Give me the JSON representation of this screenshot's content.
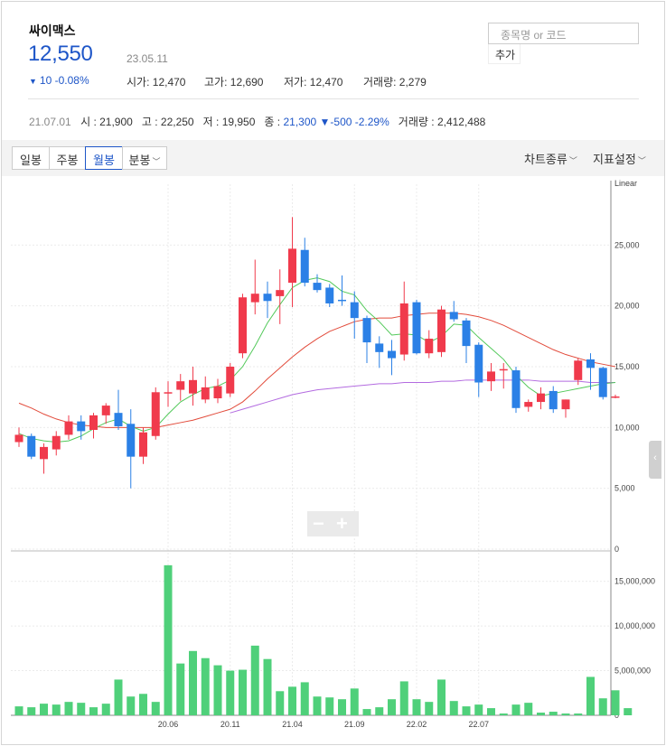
{
  "stock": {
    "name": "싸이맥스",
    "price": "12,550",
    "date": "23.05.11",
    "change_arrow": "▼",
    "change": "10 -0.08%",
    "quotes": [
      {
        "label": "시가",
        "value": "12,470"
      },
      {
        "label": "고가",
        "value": "12,690"
      },
      {
        "label": "저가",
        "value": "12,470"
      },
      {
        "label": "거래량",
        "value": "2,279"
      }
    ]
  },
  "search": {
    "placeholder": "종목명 or 코드",
    "add_label": "추가"
  },
  "history": {
    "date": "21.07.01",
    "open_label": "시",
    "open": "21,900",
    "high_label": "고",
    "high": "22,250",
    "low_label": "저",
    "low": "19,950",
    "close_label": "종",
    "close": "21,300",
    "change_arrow": "▼",
    "change": "-500 -2.29%",
    "volume_label": "거래량",
    "volume": "2,412,488"
  },
  "toolbar": {
    "periods": [
      "일봉",
      "주봉",
      "월봉",
      "분봉"
    ],
    "active_period": "월봉",
    "chart_type": "차트종류",
    "indicators": "지표설정"
  },
  "colors": {
    "up": "#f03a4c",
    "down": "#2b80e6",
    "accent": "#1e56c8",
    "volume": "#4fd07a",
    "ma5": "#52c95a",
    "ma20": "#e24b3b",
    "ma60": "#b36be0"
  },
  "zoom": {
    "minus": "−",
    "plus": "+"
  },
  "chart_data": {
    "type": "candlestick",
    "price_axis": {
      "scale_label": "Linear",
      "ticks": [
        0,
        5000,
        10000,
        15000,
        20000,
        25000
      ],
      "tick_labels": [
        "0",
        "5,000",
        "10,000",
        "15,000",
        "20,000",
        "25,000"
      ],
      "ylim": [
        0,
        30000
      ]
    },
    "volume_axis": {
      "ticks": [
        0,
        5000000,
        10000000,
        15000000
      ],
      "tick_labels": [
        "0",
        "5,000,000",
        "10,000,000",
        "15,000,000"
      ],
      "ylim": [
        0,
        18000000
      ]
    },
    "x_tick_labels": [
      {
        "index": 12,
        "label": "20.06"
      },
      {
        "index": 17,
        "label": "20.11"
      },
      {
        "index": 22,
        "label": "21.04"
      },
      {
        "index": 27,
        "label": "21.09"
      },
      {
        "index": 32,
        "label": "22.02"
      },
      {
        "index": 37,
        "label": "22.07"
      }
    ],
    "candles": [
      {
        "o": 8800,
        "h": 10000,
        "l": 8400,
        "c": 9400
      },
      {
        "o": 9300,
        "h": 9500,
        "l": 7400,
        "c": 7600
      },
      {
        "o": 7400,
        "h": 8700,
        "l": 6200,
        "c": 8400
      },
      {
        "o": 8200,
        "h": 9700,
        "l": 7700,
        "c": 9300
      },
      {
        "o": 9400,
        "h": 11000,
        "l": 9000,
        "c": 10500
      },
      {
        "o": 10500,
        "h": 11000,
        "l": 9000,
        "c": 9700
      },
      {
        "o": 9800,
        "h": 11200,
        "l": 9100,
        "c": 11000
      },
      {
        "o": 11000,
        "h": 12000,
        "l": 10300,
        "c": 11800
      },
      {
        "o": 11200,
        "h": 13100,
        "l": 9800,
        "c": 10100
      },
      {
        "o": 10300,
        "h": 11500,
        "l": 5000,
        "c": 7600
      },
      {
        "o": 7600,
        "h": 10000,
        "l": 7000,
        "c": 9600
      },
      {
        "o": 9300,
        "h": 13300,
        "l": 9000,
        "c": 12900
      },
      {
        "o": 12800,
        "h": 13800,
        "l": 11700,
        "c": 12900
      },
      {
        "o": 13100,
        "h": 14400,
        "l": 12200,
        "c": 13800
      },
      {
        "o": 12800,
        "h": 15000,
        "l": 11800,
        "c": 13900
      },
      {
        "o": 12300,
        "h": 14200,
        "l": 12000,
        "c": 13300
      },
      {
        "o": 12400,
        "h": 14000,
        "l": 12000,
        "c": 13400
      },
      {
        "o": 12800,
        "h": 15300,
        "l": 12500,
        "c": 15000
      },
      {
        "o": 16100,
        "h": 21000,
        "l": 15700,
        "c": 20700
      },
      {
        "o": 20300,
        "h": 23800,
        "l": 19300,
        "c": 21000
      },
      {
        "o": 21000,
        "h": 22000,
        "l": 19000,
        "c": 20400
      },
      {
        "o": 20800,
        "h": 23000,
        "l": 18500,
        "c": 21300
      },
      {
        "o": 21900,
        "h": 27300,
        "l": 19900,
        "c": 24700
      },
      {
        "o": 24600,
        "h": 25600,
        "l": 21600,
        "c": 21900
      },
      {
        "o": 21900,
        "h": 22600,
        "l": 21100,
        "c": 21300
      },
      {
        "o": 21500,
        "h": 21800,
        "l": 19900,
        "c": 20200
      },
      {
        "o": 20500,
        "h": 22500,
        "l": 20000,
        "c": 20400
      },
      {
        "o": 20300,
        "h": 21200,
        "l": 17300,
        "c": 19000
      },
      {
        "o": 19000,
        "h": 19200,
        "l": 15300,
        "c": 17000
      },
      {
        "o": 16900,
        "h": 17500,
        "l": 14900,
        "c": 16200
      },
      {
        "o": 16300,
        "h": 17200,
        "l": 14300,
        "c": 15700
      },
      {
        "o": 16000,
        "h": 22000,
        "l": 15500,
        "c": 20200
      },
      {
        "o": 20300,
        "h": 20500,
        "l": 16000,
        "c": 16100
      },
      {
        "o": 16100,
        "h": 18000,
        "l": 15700,
        "c": 17300
      },
      {
        "o": 16200,
        "h": 20000,
        "l": 15800,
        "c": 19700
      },
      {
        "o": 19500,
        "h": 20400,
        "l": 18700,
        "c": 18900
      },
      {
        "o": 18800,
        "h": 19000,
        "l": 15300,
        "c": 16700
      },
      {
        "o": 16800,
        "h": 17000,
        "l": 12500,
        "c": 13700
      },
      {
        "o": 13800,
        "h": 15300,
        "l": 13000,
        "c": 14600
      },
      {
        "o": 14800,
        "h": 15300,
        "l": 13200,
        "c": 14800
      },
      {
        "o": 14700,
        "h": 15000,
        "l": 11200,
        "c": 11600
      },
      {
        "o": 11700,
        "h": 12300,
        "l": 11300,
        "c": 12100
      },
      {
        "o": 12100,
        "h": 13300,
        "l": 11500,
        "c": 12800
      },
      {
        "o": 13000,
        "h": 13400,
        "l": 11200,
        "c": 11500
      },
      {
        "o": 11500,
        "h": 12300,
        "l": 10800,
        "c": 12300
      },
      {
        "o": 13900,
        "h": 15700,
        "l": 13500,
        "c": 15500
      },
      {
        "o": 15600,
        "h": 16100,
        "l": 13100,
        "c": 14900
      },
      {
        "o": 14900,
        "h": 15000,
        "l": 12300,
        "c": 12500
      },
      {
        "o": 12500,
        "h": 12700,
        "l": 12400,
        "c": 12550
      }
    ],
    "volumes": [
      1000000,
      900000,
      1300000,
      1200000,
      1500000,
      1400000,
      900000,
      1300000,
      4000000,
      2100000,
      2400000,
      1500000,
      16800000,
      5800000,
      7200000,
      6400000,
      5600000,
      5000000,
      5100000,
      7800000,
      6300000,
      2700000,
      3200000,
      3700000,
      2100000,
      2000000,
      1800000,
      3000000,
      700000,
      900000,
      1800000,
      3800000,
      1800000,
      1500000,
      4000000,
      1600000,
      1000000,
      1200000,
      800000,
      200000,
      1200000,
      1400000,
      300000,
      400000,
      200000,
      200000,
      4300000,
      1900000,
      2800000,
      800000
    ],
    "ma5": [
      9500,
      9100,
      8900,
      8800,
      8900,
      9300,
      9900,
      10400,
      10700,
      10100,
      9700,
      10000,
      11100,
      12100,
      12700,
      13200,
      13400,
      13900,
      15000,
      16700,
      18600,
      20100,
      21500,
      22100,
      22300,
      22000,
      21200,
      20900,
      19600,
      18700,
      17600,
      17700,
      17600,
      17000,
      17500,
      18500,
      18400,
      17400,
      16500,
      15600,
      14300,
      13300,
      12600,
      12800,
      13000,
      13200,
      13400,
      13600,
      13700
    ],
    "ma20": [
      12000,
      11600,
      11100,
      10700,
      10400,
      10200,
      10100,
      10000,
      10000,
      10000,
      10000,
      10000,
      10200,
      10400,
      10600,
      10900,
      11200,
      11500,
      12100,
      13000,
      14000,
      14900,
      15800,
      16600,
      17300,
      17900,
      18300,
      18700,
      18900,
      19000,
      19000,
      19200,
      19300,
      19400,
      19400,
      19400,
      19300,
      19100,
      18800,
      18400,
      17900,
      17400,
      16900,
      16400,
      16000,
      15700,
      15400,
      15200,
      15000
    ],
    "ma60": [
      null,
      null,
      null,
      null,
      null,
      null,
      null,
      null,
      null,
      null,
      null,
      null,
      null,
      null,
      null,
      null,
      null,
      11200,
      11500,
      11800,
      12100,
      12400,
      12700,
      12900,
      13100,
      13200,
      13300,
      13400,
      13500,
      13600,
      13600,
      13700,
      13700,
      13700,
      13800,
      13800,
      13900,
      13900,
      13900,
      13900,
      13900,
      13900,
      13800,
      13800,
      13800,
      13800,
      13700,
      13700,
      13700
    ]
  }
}
